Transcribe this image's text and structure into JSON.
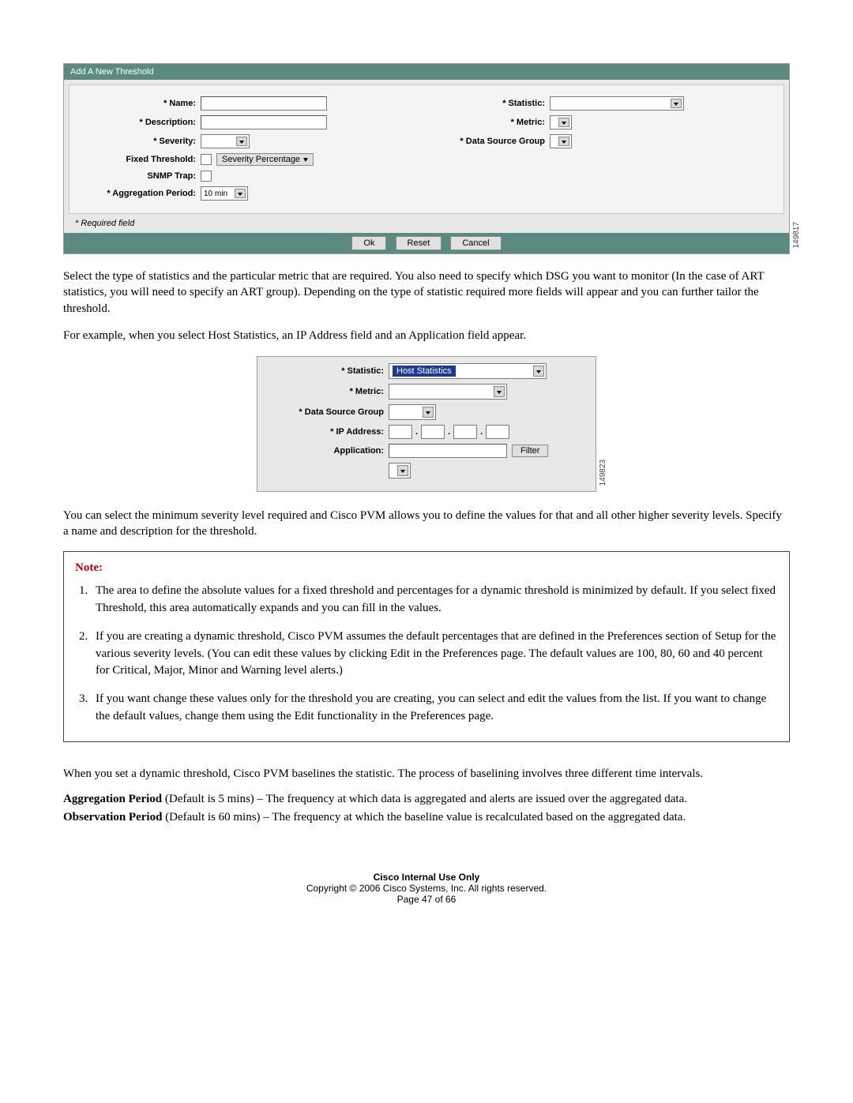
{
  "panel": {
    "title": "Add A New Threshold",
    "left": {
      "name": "* Name:",
      "description": "* Description:",
      "severity": "* Severity:",
      "fixed": "Fixed Threshold:",
      "sev_pct_btn": "Severity   Percentage",
      "snmp": "SNMP Trap:",
      "agg": "* Aggregation Period:",
      "agg_val": "10  min"
    },
    "right": {
      "statistic": "* Statistic:",
      "metric": "* Metric:",
      "dsg": "* Data Source Group"
    },
    "req": "* Required field",
    "buttons": {
      "ok": "Ok",
      "reset": "Reset",
      "cancel": "Cancel"
    },
    "code": "149817"
  },
  "para1": "Select the type of statistics and the particular metric that are required. You also need to specify which DSG you want to monitor (In the case of ART statistics, you will need to specify an ART group). Depending on the type of statistic required more fields will appear and you can further tailor the threshold.",
  "para2": "For example, when you select Host Statistics, an IP Address field and an Application field appear.",
  "fig2": {
    "statistic_lbl": "* Statistic:",
    "statistic_val": "Host Statistics",
    "metric_lbl": "* Metric:",
    "dsg_lbl": "* Data Source Group",
    "ip_lbl": "* IP Address:",
    "app_lbl": "Application:",
    "filter": "Filter",
    "code": "149823"
  },
  "para3": "You can select the minimum severity level required and Cisco PVM allows you to define the values for that and all other higher severity levels. Specify a name and description for the threshold.",
  "note": {
    "heading": "Note:",
    "items": [
      "The area to define the absolute values for a fixed threshold and percentages for a dynamic threshold is minimized by default. If you select fixed Threshold, this area automatically expands and you can fill in the values.",
      "If you are creating a dynamic threshold, Cisco PVM assumes the default percentages that are defined in the Preferences section of Setup for the various severity levels. (You can edit these values by clicking Edit in the Preferences page. The default values are 100, 80, 60 and 40 percent for Critical, Major, Minor and Warning level alerts.)",
      "If you want change these values only for the threshold you are creating, you can select and edit the values from the list. If you want to change the default values, change them using the Edit functionality in the Preferences page."
    ]
  },
  "para4": "When you set a dynamic threshold, Cisco PVM baselines the statistic. The process of baselining involves three different time intervals.",
  "defs": {
    "agg_b": "Aggregation Period",
    "agg_t": " (Default is 5 mins) – The frequency at which data is aggregated and alerts are issued over the aggregated data.",
    "obs_b": "Observation Period",
    "obs_t": " (Default is 60 mins) – The frequency at which the baseline value is recalculated based on the aggregated data."
  },
  "footer": {
    "l1": "Cisco Internal Use Only",
    "l2": "Copyright © 2006 Cisco Systems, Inc. All rights reserved.",
    "l3": "Page 47 of 66"
  }
}
